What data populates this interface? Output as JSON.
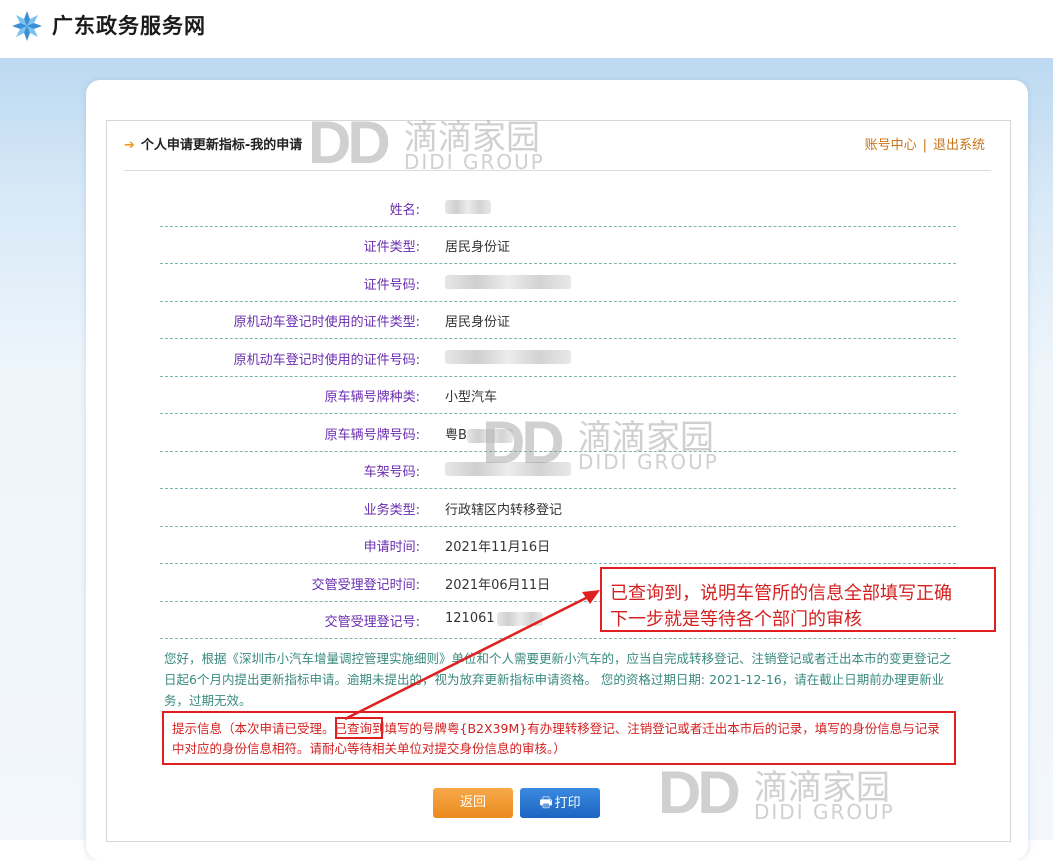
{
  "header": {
    "site_title": "广东政务服务网"
  },
  "panel": {
    "title": "个人申请更新指标-我的申请",
    "links": {
      "account": "账号中心",
      "separator": "|",
      "logout": "退出系统"
    }
  },
  "fields": [
    {
      "label": "姓名:",
      "value": ""
    },
    {
      "label": "证件类型:",
      "value": "居民身份证"
    },
    {
      "label": "证件号码:",
      "value": ""
    },
    {
      "label": "原机动车登记时使用的证件类型:",
      "value": "居民身份证"
    },
    {
      "label": "原机动车登记时使用的证件号码:",
      "value": ""
    },
    {
      "label": "原车辆号牌种类:",
      "value": "小型汽车"
    },
    {
      "label": "原车辆号牌号码:",
      "value": "粤B"
    },
    {
      "label": "车架号码:",
      "value": ""
    },
    {
      "label": "业务类型:",
      "value": "行政辖区内转移登记"
    },
    {
      "label": "申请时间:",
      "value": "2021年11月16日"
    },
    {
      "label": "交管受理登记时间:",
      "value": "2021年06月11日"
    },
    {
      "label": "交管受理登记号:",
      "value": "121061"
    }
  ],
  "notice": "您好，根据《深圳市小汽车增量调控管理实施细则》单位和个人需要更新小汽车的，应当自完成转移登记、注销登记或者迁出本市的变更登记之日起6个月内提出更新指标申请。逾期未提出的，视为放弃更新指标申请资格。 您的资格过期日期: 2021-12-16，请在截止日期前办理更新业务，过期无效。",
  "tip": "提示信息（本次申请已受理。已查询到填写的号牌粤{B2X39M}有办理转移登记、注销登记或者迁出本市后的记录，填写的身份信息与记录中对应的身份信息相符。请耐心等待相关单位对提交身份信息的审核。）",
  "annotation": {
    "line1": "已查询到，说明车管所的信息全部填写正确",
    "line2": "下一步就是等待各个部门的审核"
  },
  "buttons": {
    "back": "返回",
    "print": "打印"
  },
  "watermark": {
    "logo": "DD",
    "cn": "滴滴家园",
    "en": "DIDI GROUP"
  },
  "colors": {
    "accent_orange": "#ea8a1e",
    "print_blue": "#1d64c0",
    "annotation_red": "#e02020",
    "label_purple": "#6a2db0",
    "teal_text": "#3a8a7f"
  }
}
